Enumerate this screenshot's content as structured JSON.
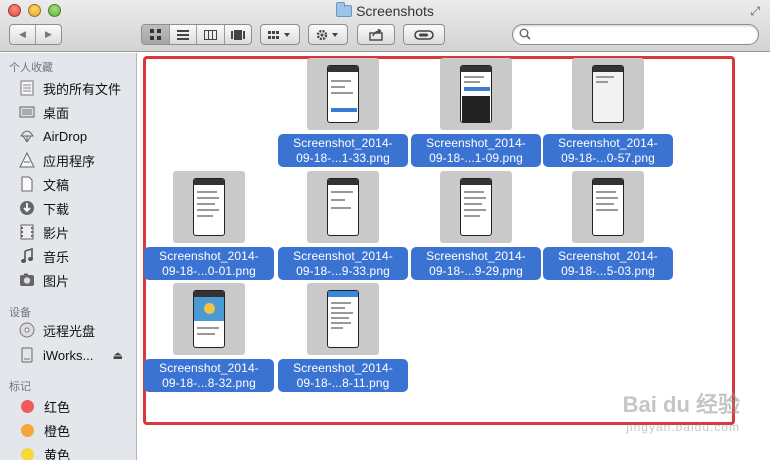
{
  "window": {
    "title": "Screenshots"
  },
  "toolbar": {
    "back_glyph": "◀",
    "forward_glyph": "▶",
    "view_icons": [
      "icon-view-icon",
      "list-view-icon",
      "column-view-icon",
      "coverflow-view-icon"
    ],
    "arrange_icon": "arrange-icon",
    "action_icon": "gear-icon",
    "share_icon": "share-icon",
    "tag_icon": "tag-icon",
    "search_placeholder": ""
  },
  "sidebar": {
    "favorites_header": "个人收藏",
    "favorites": [
      {
        "label": "我的所有文件",
        "icon": "all-files-icon"
      },
      {
        "label": "桌面",
        "icon": "desktop-icon"
      },
      {
        "label": "AirDrop",
        "icon": "airdrop-icon"
      },
      {
        "label": "应用程序",
        "icon": "applications-icon"
      },
      {
        "label": "文稿",
        "icon": "documents-icon"
      },
      {
        "label": "下载",
        "icon": "downloads-icon"
      },
      {
        "label": "影片",
        "icon": "movies-icon"
      },
      {
        "label": "音乐",
        "icon": "music-icon"
      },
      {
        "label": "图片",
        "icon": "pictures-icon"
      }
    ],
    "devices_header": "设备",
    "devices": [
      {
        "label": "远程光盘",
        "icon": "remote-disc-icon"
      },
      {
        "label": "iWorks...",
        "icon": "drive-icon"
      }
    ],
    "tags_header": "标记",
    "tags": [
      {
        "label": "红色",
        "color": "#f25b5b"
      },
      {
        "label": "橙色",
        "color": "#f6a53c"
      },
      {
        "label": "黄色",
        "color": "#f5d83a"
      }
    ]
  },
  "files": [
    {
      "line1": "Screenshot_2014-",
      "line2": "09-18-...1-33.png"
    },
    {
      "line1": "Screenshot_2014-",
      "line2": "09-18-...1-09.png"
    },
    {
      "line1": "Screenshot_2014-",
      "line2": "09-18-...0-57.png"
    },
    {
      "line1": "Screenshot_2014-",
      "line2": "09-18-...0-01.png"
    },
    {
      "line1": "Screenshot_2014-",
      "line2": "09-18-...9-33.png"
    },
    {
      "line1": "Screenshot_2014-",
      "line2": "09-18-...9-29.png"
    },
    {
      "line1": "Screenshot_2014-",
      "line2": "09-18-...5-03.png"
    },
    {
      "line1": "Screenshot_2014-",
      "line2": "09-18-...8-32.png"
    },
    {
      "line1": "Screenshot_2014-",
      "line2": "09-18-...8-11.png"
    }
  ],
  "watermark": {
    "main": "Bai du 经验",
    "sub": "jingyan.baidu.com"
  },
  "colors": {
    "selection": "#3b73d3",
    "highlight_border": "#d7373d"
  }
}
